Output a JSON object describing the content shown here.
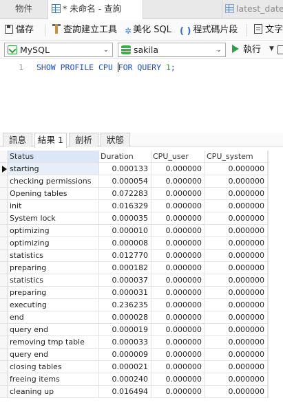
{
  "tabs": [
    {
      "label": "物件"
    },
    {
      "label": "* 未命名 - 查詢"
    },
    {
      "label": "latest_date_v"
    }
  ],
  "toolbar": {
    "save_label": "儲存",
    "builder_label": "查詢建立工具",
    "beautify_label": "美化 SQL",
    "snippet_label": "程式碼片段",
    "text_label": "文字"
  },
  "connection": {
    "engine": "MySQL",
    "database": "sakila",
    "run_label": "執行"
  },
  "editor": {
    "line_number": "1",
    "sql_before_caret": "SHOW PROFILE CPU ",
    "sql_after_caret": "FOR QUERY ",
    "sql_number": "1",
    "sql_end": ";"
  },
  "result_tabs": [
    {
      "label": "訊息"
    },
    {
      "label": "結果 1"
    },
    {
      "label": "剖析"
    },
    {
      "label": "狀態"
    }
  ],
  "grid": {
    "columns": [
      "Status",
      "Duration",
      "CPU_user",
      "CPU_system"
    ],
    "rows": [
      [
        "starting",
        "0.000133",
        "0.000000",
        "0.000000"
      ],
      [
        "checking permissions",
        "0.000054",
        "0.000000",
        "0.000000"
      ],
      [
        "Opening tables",
        "0.072283",
        "0.000000",
        "0.000000"
      ],
      [
        "init",
        "0.016329",
        "0.000000",
        "0.000000"
      ],
      [
        "System lock",
        "0.000035",
        "0.000000",
        "0.000000"
      ],
      [
        "optimizing",
        "0.000010",
        "0.000000",
        "0.000000"
      ],
      [
        "optimizing",
        "0.000008",
        "0.000000",
        "0.000000"
      ],
      [
        "statistics",
        "0.012770",
        "0.000000",
        "0.000000"
      ],
      [
        "preparing",
        "0.000182",
        "0.000000",
        "0.000000"
      ],
      [
        "statistics",
        "0.000037",
        "0.000000",
        "0.000000"
      ],
      [
        "preparing",
        "0.000031",
        "0.000000",
        "0.000000"
      ],
      [
        "executing",
        "0.236235",
        "0.000000",
        "0.000000"
      ],
      [
        "end",
        "0.000028",
        "0.000000",
        "0.000000"
      ],
      [
        "query end",
        "0.000019",
        "0.000000",
        "0.000000"
      ],
      [
        "removing tmp table",
        "0.000033",
        "0.000000",
        "0.000000"
      ],
      [
        "query end",
        "0.000009",
        "0.000000",
        "0.000000"
      ],
      [
        "closing tables",
        "0.000021",
        "0.000000",
        "0.000000"
      ],
      [
        "freeing items",
        "0.000240",
        "0.000000",
        "0.000000"
      ],
      [
        "cleaning up",
        "0.016494",
        "0.000000",
        "0.000000"
      ]
    ]
  }
}
